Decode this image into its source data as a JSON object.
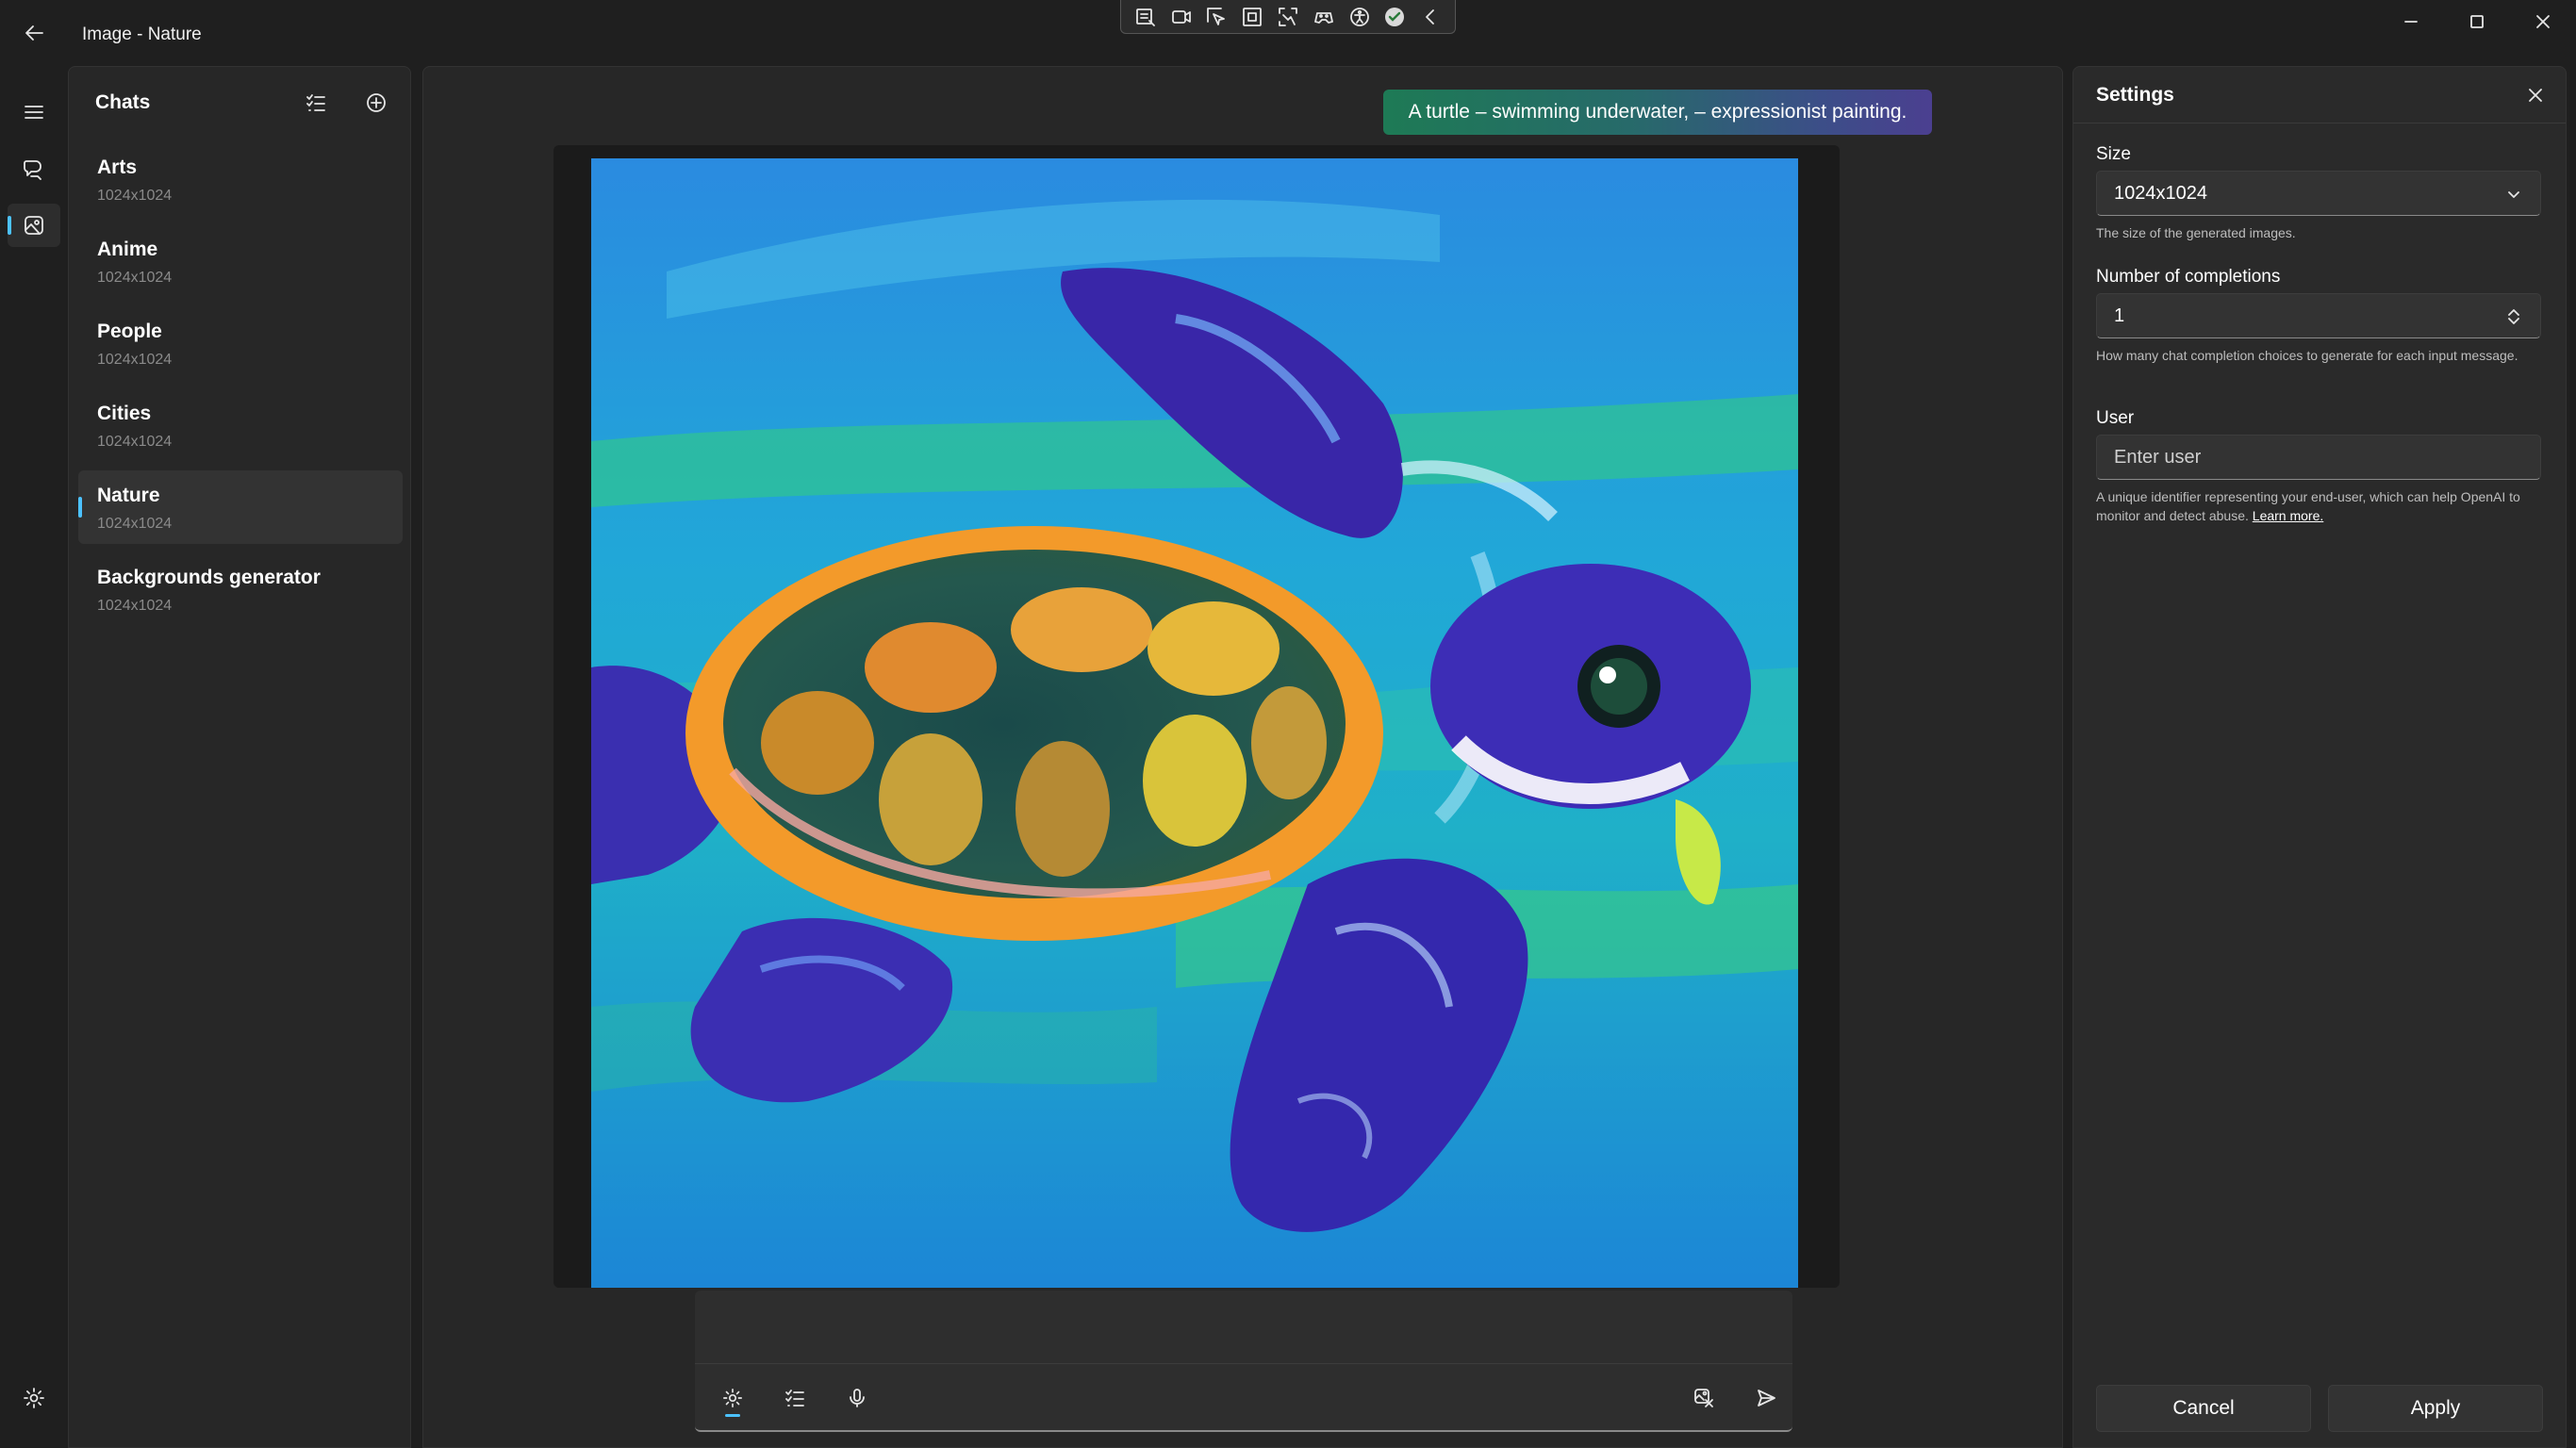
{
  "window": {
    "title": "Image - Nature"
  },
  "colors": {
    "accent": "#4cc2ff",
    "background": "#1f1f1f",
    "panel": "#272727",
    "prompt_gradient_start": "#1e7a55",
    "prompt_gradient_end": "#4b3f90"
  },
  "float_toolbar": {
    "icons": [
      "select-screen-icon",
      "record-icon",
      "cursor-select-icon",
      "region-icon",
      "crop-icon",
      "gamepad-icon",
      "accessibility-icon",
      "checkmark-icon",
      "collapse-chevron-icon"
    ]
  },
  "nav_rail": {
    "items": [
      "menu-icon",
      "chat-icon",
      "image-icon"
    ],
    "active": "image-icon",
    "bottom": "settings-icon"
  },
  "chats": {
    "title": "Chats",
    "items": [
      {
        "name": "Arts",
        "size": "1024x1024"
      },
      {
        "name": "Anime",
        "size": "1024x1024"
      },
      {
        "name": "People",
        "size": "1024x1024"
      },
      {
        "name": "Cities",
        "size": "1024x1024"
      },
      {
        "name": "Nature",
        "size": "1024x1024"
      },
      {
        "name": "Backgrounds generator",
        "size": "1024x1024"
      }
    ],
    "selected": "Nature"
  },
  "main": {
    "prompt": "A turtle – swimming underwater, – expressionist painting.",
    "composer": {
      "input_value": "",
      "tools": [
        "settings-icon",
        "list-icon",
        "microphone-icon",
        "image-compare-icon",
        "send-icon"
      ],
      "active_tool": "settings-icon"
    }
  },
  "settings": {
    "title": "Settings",
    "size": {
      "label": "Size",
      "value": "1024x1024",
      "help": "The size of the generated images."
    },
    "completions": {
      "label": "Number of completions",
      "value": "1",
      "help": "How many chat completion choices to generate for each input message."
    },
    "user": {
      "label": "User",
      "placeholder": "Enter user",
      "help": "A unique identifier representing your end-user, which can help OpenAI to monitor and detect abuse.",
      "link": "Learn more."
    },
    "cancel_label": "Cancel",
    "apply_label": "Apply"
  }
}
